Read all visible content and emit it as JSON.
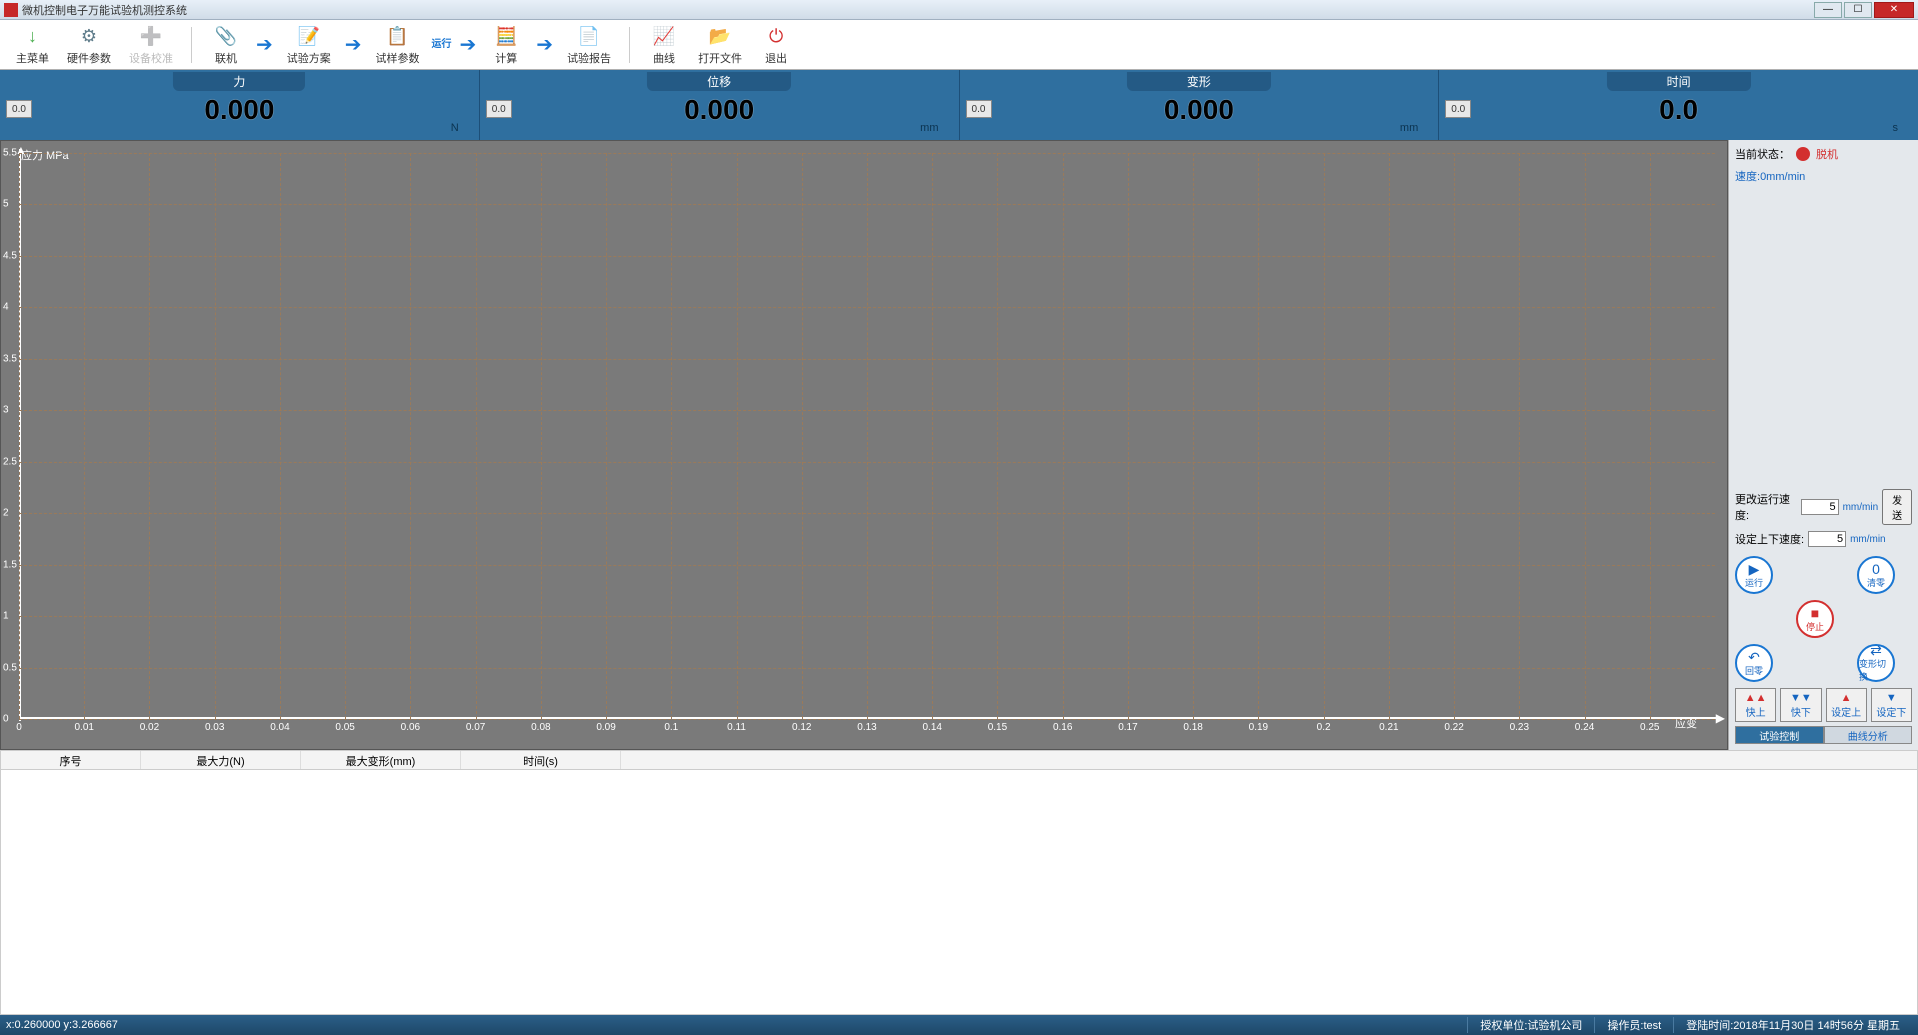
{
  "window": {
    "title": "微机控制电子万能试验机测控系统"
  },
  "toolbar": [
    {
      "id": "main-menu",
      "label": "主菜单",
      "icon": "↓",
      "color": "#4caf50"
    },
    {
      "id": "hw-params",
      "label": "硬件参数",
      "icon": "⚙",
      "color": "#607d8b"
    },
    {
      "id": "calibrate",
      "label": "设备校准",
      "icon": "➕",
      "color": "#9e9e9e",
      "disabled": true
    },
    {
      "sep": true
    },
    {
      "id": "connect",
      "label": "联机",
      "icon": "📎",
      "color": "#455a64"
    },
    {
      "arrow": true
    },
    {
      "id": "test-plan",
      "label": "试验方案",
      "icon": "📝",
      "color": "#1976d2"
    },
    {
      "arrow": true
    },
    {
      "id": "sample-params",
      "label": "试样参数",
      "icon": "📋",
      "color": "#1976d2"
    },
    {
      "runtag": "运行"
    },
    {
      "id": "compute",
      "label": "计算",
      "icon": "🧮",
      "color": "#455a64"
    },
    {
      "arrow": true
    },
    {
      "id": "report",
      "label": "试验报告",
      "icon": "📄",
      "color": "#1976d2"
    },
    {
      "sep": true
    },
    {
      "id": "curve",
      "label": "曲线",
      "icon": "📈",
      "color": "#d32f2f"
    },
    {
      "id": "open-file",
      "label": "打开文件",
      "icon": "📂",
      "color": "#fbc02d"
    },
    {
      "id": "exit",
      "label": "退出",
      "icon": "⏻",
      "color": "#d32f2f"
    }
  ],
  "readouts": {
    "force": {
      "label": "力",
      "value": "0.000",
      "small": "0.0",
      "unit": "N"
    },
    "disp": {
      "label": "位移",
      "value": "0.000",
      "small": "0.0",
      "unit": "mm"
    },
    "deform": {
      "label": "变形",
      "value": "0.000",
      "small": "0.0",
      "unit": "mm"
    },
    "time": {
      "label": "时间",
      "value": "0.0",
      "small": "0.0",
      "unit": "s"
    }
  },
  "chart_data": {
    "type": "line",
    "title": "",
    "xlabel": "应变",
    "ylabel": "应力 MPa",
    "xlim": [
      0,
      0.26
    ],
    "ylim": [
      0,
      5.5
    ],
    "x_ticks": [
      0,
      0.01,
      0.02,
      0.03,
      0.04,
      0.05,
      0.06,
      0.07,
      0.08,
      0.09,
      0.1,
      0.11,
      0.12,
      0.13,
      0.14,
      0.15,
      0.16,
      0.17,
      0.18,
      0.19,
      0.2,
      0.21,
      0.22,
      0.23,
      0.24,
      0.25
    ],
    "y_ticks": [
      0,
      0.5,
      1,
      1.5,
      2,
      2.5,
      3,
      3.5,
      4,
      4.5,
      5,
      5.5
    ],
    "series": []
  },
  "side": {
    "status_label": "当前状态：",
    "status_value": "脱机",
    "speed_label": "速度:",
    "speed_value": "0mm/min",
    "run_speed_label": "更改运行速度:",
    "run_speed_value": "5",
    "run_speed_unit": "mm/min",
    "send_btn": "发送",
    "updown_label": "设定上下速度:",
    "updown_value": "5",
    "updown_unit": "mm/min",
    "buttons": {
      "run": "运行",
      "zero": "清零",
      "home": "回零",
      "stop": "停止",
      "switch": "变形切换",
      "fast_up": "快上",
      "fast_down": "快下",
      "set_up": "设定上",
      "set_down": "设定下"
    },
    "tabs": {
      "control": "试验控制",
      "analysis": "曲线分析"
    }
  },
  "table": {
    "cols": [
      "序号",
      "最大力(N)",
      "最大变形(mm)",
      "时间(s)"
    ]
  },
  "statusbar": {
    "coords": "x:0.260000 y:3.266667",
    "auth": "授权单位:试验机公司",
    "operator": "操作员:test",
    "login": "登陆时间:2018年11月30日 14时56分 星期五"
  }
}
